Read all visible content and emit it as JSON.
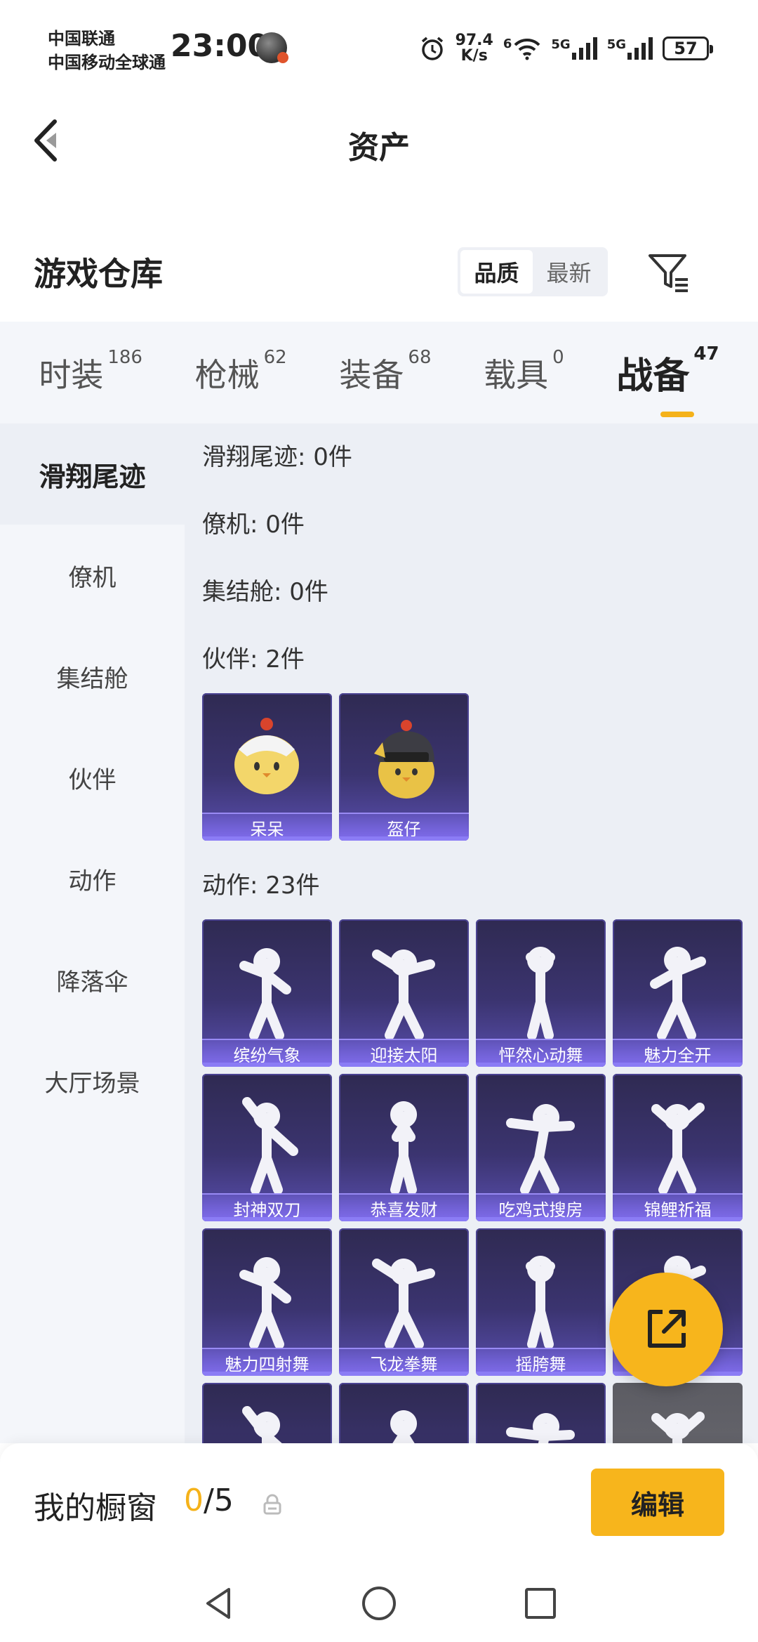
{
  "status_bar": {
    "carrier_1": "中国联通",
    "carrier_2": "中国移动全球通",
    "time": "23:00",
    "net_speed_value": "97.4",
    "net_speed_unit": "K/s",
    "wifi_label": "6",
    "sig1_label": "5G",
    "sig2_label": "5G",
    "battery": "57"
  },
  "nav": {
    "title": "资产"
  },
  "section": {
    "title": "游戏仓库",
    "sort_options": [
      "品质",
      "最新"
    ],
    "sort_selected": "品质"
  },
  "tabs": [
    {
      "label": "时装",
      "count": "186"
    },
    {
      "label": "枪械",
      "count": "62"
    },
    {
      "label": "装备",
      "count": "68"
    },
    {
      "label": "载具",
      "count": "0"
    },
    {
      "label": "战备",
      "count": "47",
      "active": true
    }
  ],
  "sidebar": {
    "items": [
      "滑翔尾迹",
      "僚机",
      "集结舱",
      "伙伴",
      "动作",
      "降落伞",
      "大厅场景"
    ],
    "active": "滑翔尾迹"
  },
  "groups": {
    "glide_trail": "滑翔尾迹: 0件",
    "wingman": "僚机: 0件",
    "rally_pod": "集结舱: 0件",
    "partner": "伙伴: 2件",
    "emote": "动作: 23件"
  },
  "partner_cards": [
    "呆呆",
    "盔仔"
  ],
  "emote_cards": [
    "缤纷气象",
    "迎接太阳",
    "怦然心动舞",
    "魅力全开",
    "封神双刀",
    "恭喜发财",
    "吃鸡式搜房",
    "锦鲤祈福",
    "魅力四射舞",
    "飞龙拳舞",
    "摇胯舞",
    "",
    "",
    "",
    "",
    ""
  ],
  "showcase": {
    "title": "我的橱窗",
    "used": "0",
    "total": "/5",
    "edit_label": "编辑"
  },
  "colors": {
    "accent": "#f7b51c",
    "card_top": "#2f2a52",
    "card_bottom": "#5a4fb0",
    "card_label_bar": "#8b7cf5",
    "page_bg": "#eceff5"
  }
}
